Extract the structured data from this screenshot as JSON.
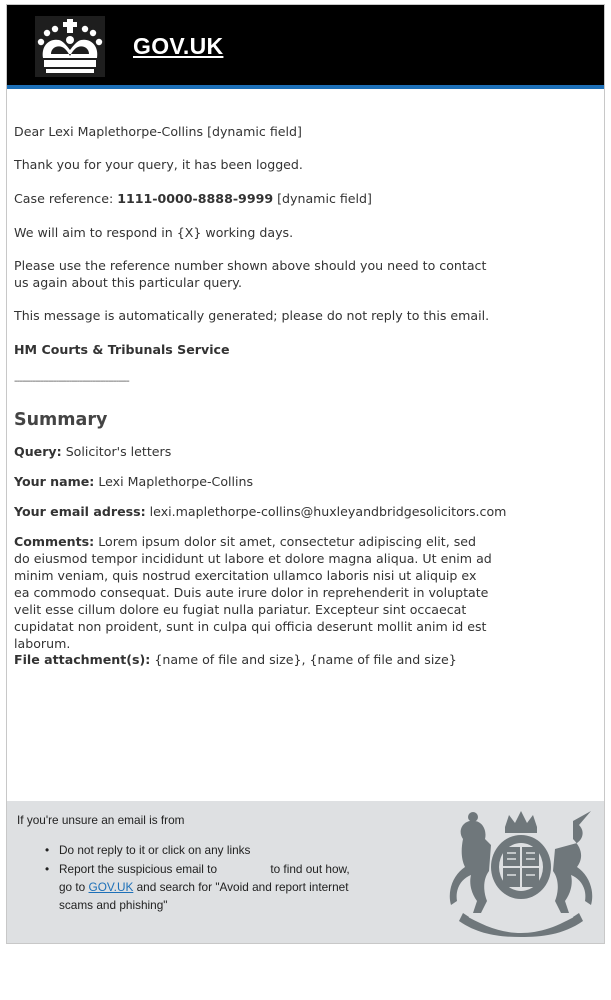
{
  "header": {
    "brand": "GOV.UK",
    "logo_icon": "crown-icon"
  },
  "colors": {
    "header_bg": "#000000",
    "accent_bar": "#1d70b8",
    "footer_bg": "#dee0e2",
    "link": "#1d70b8"
  },
  "email": {
    "greeting": "Dear Lexi Maplethorpe-Collins [dynamic field]",
    "thanks": "Thank you for your query, it has been logged.",
    "case_label": "Case reference:",
    "case_ref": "1111-0000-8888-9999",
    "case_suffix": "[dynamic field]",
    "respond": "We will aim to respond in {X} working days.",
    "please": "Please use the reference number shown above should you need to contact us again about this particular query.",
    "auto": "This message is automatically generated; please do not reply to this email.",
    "org": "HM Courts & Tribunals Service",
    "divider": "--------------------------------------------"
  },
  "summary": {
    "title": "Summary",
    "query_label": "Query:",
    "query_value": "Solicitor's letters",
    "name_label": "Your name:",
    "name_value": "Lexi Maplethorpe-Collins",
    "email_label": "Your email adress:",
    "email_value": "lexi.maplethorpe-collins@huxleyandbridgesolicitors.com",
    "comments_label": "Comments:",
    "comments_value": "Lorem ipsum dolor sit amet, consectetur adipiscing elit, sed do eiusmod tempor incididunt ut labore et dolore magna aliqua. Ut enim ad minim veniam, quis nostrud exercitation ullamco laboris nisi ut aliquip ex ea commodo consequat. Duis aute irure dolor in reprehenderit in voluptate velit esse cillum dolore eu fugiat nulla pariatur. Excepteur sint occaecat cupidatat non proident, sunt in culpa qui officia deserunt mollit anim id est laborum.",
    "files_label": "File attachment(s):",
    "files_value": "{name of file and size}, {name of file and size}"
  },
  "footer": {
    "intro": "If you're unsure an email is from",
    "item1": "Do not reply to it or click on any links",
    "item2_a": "Report the suspicious email to",
    "item2_b": "to find out how, go to",
    "item2_link": "GOV.UK",
    "item2_c": "and search for \"Avoid and report internet scams and phishing\"",
    "arms_icon": "royal-coat-of-arms-icon",
    "arms_motto": "DIEU ET MON DROIT"
  }
}
